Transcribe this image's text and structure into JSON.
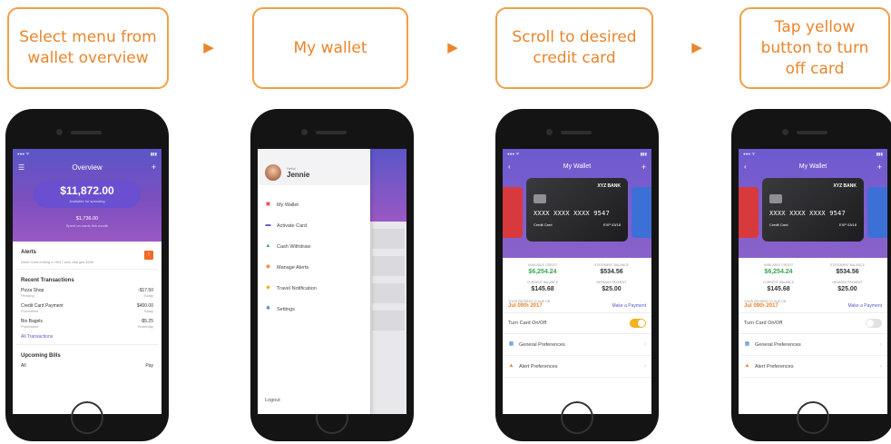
{
  "steps": [
    {
      "label": "Select menu from wallet overview"
    },
    {
      "label": "My wallet"
    },
    {
      "label": "Scroll to desired credit card"
    },
    {
      "label": "Tap yellow button to turn off card"
    }
  ],
  "arrow_glyph": "▶",
  "colors": {
    "accent": "#e9852b",
    "header_purple": "#7c4fbf",
    "toggle_on": "#f5b21f",
    "positive": "#3aa653"
  },
  "overview": {
    "title": "Overview",
    "balance": "$11,872.00",
    "balance_sub": "Available for spending",
    "spent": "$1,736.00",
    "spent_sub": "Spent on cards this month",
    "alerts": {
      "title": "Alerts",
      "text": "Debit Card ending in 9547 was charged $200",
      "badge": "!"
    },
    "recent": {
      "title": "Recent Transactions",
      "rows": [
        {
          "name": "Pizza Shop",
          "status": "Pending",
          "amount": "-$17.50",
          "when": "Today"
        },
        {
          "name": "Credit Card Payment",
          "status": "Processed",
          "amount": "$400.00",
          "when": "Today"
        },
        {
          "name": "Bio Bagels",
          "status": "Processed",
          "amount": "-$5.25",
          "when": "Yesterday"
        }
      ],
      "link": "All Transactions"
    },
    "bills": {
      "title": "Upcoming Bills",
      "col_left": "All",
      "col_right": "Pay"
    }
  },
  "drawer": {
    "greeting": "Hello!",
    "user": "Jennie",
    "items": [
      {
        "label": "My Wallet",
        "icon": "wallet-icon",
        "glyph": "▣",
        "color": "#e85050"
      },
      {
        "label": "Activate Card",
        "icon": "card-icon",
        "glyph": "▬",
        "color": "#4a56c8"
      },
      {
        "label": "Cash Withdraw",
        "icon": "cash-icon",
        "glyph": "▲",
        "color": "#3aa653"
      },
      {
        "label": "Manage Alerts",
        "icon": "bell-icon",
        "glyph": "◉",
        "color": "#f08030"
      },
      {
        "label": "Travel Notification",
        "icon": "travel-icon",
        "glyph": "◆",
        "color": "#f5b21f"
      },
      {
        "label": "Settings",
        "icon": "gear-icon",
        "glyph": "✱",
        "color": "#4a86d0"
      }
    ],
    "logout": "Logout"
  },
  "wallet": {
    "title": "My Wallet",
    "bank": "XYZ BANK",
    "card_number": "XXXX XXXX XXXX 9547",
    "card_type": "Credit Card",
    "exp": "EXP 03/18",
    "stats": [
      {
        "label": "AVAILABLE CREDIT",
        "value": "$6,254.24",
        "style": "green"
      },
      {
        "label": "STATEMENT BALANCE",
        "value": "$534.56",
        "style": ""
      },
      {
        "label": "CURRENT BALANCE",
        "value": "$145.68",
        "style": ""
      },
      {
        "label": "MINIMUM PAYMENT",
        "value": "$25.00",
        "style": ""
      }
    ],
    "due_label": "YOUR PAYMENT IS DUE ON",
    "due_date": "Jul 09th 2017",
    "pay_link": "Make a Payment",
    "toggle_label": "Turn Card On/Off",
    "prefs": [
      {
        "label": "General Preferences",
        "icon": "preferences-icon",
        "glyph": "▦",
        "color": "#4a86d0"
      },
      {
        "label": "Alert Preferences",
        "icon": "alert-icon",
        "glyph": "▲",
        "color": "#f08030"
      }
    ]
  },
  "phone3": {
    "toggle_on": true
  },
  "phone4": {
    "toggle_on": false
  }
}
